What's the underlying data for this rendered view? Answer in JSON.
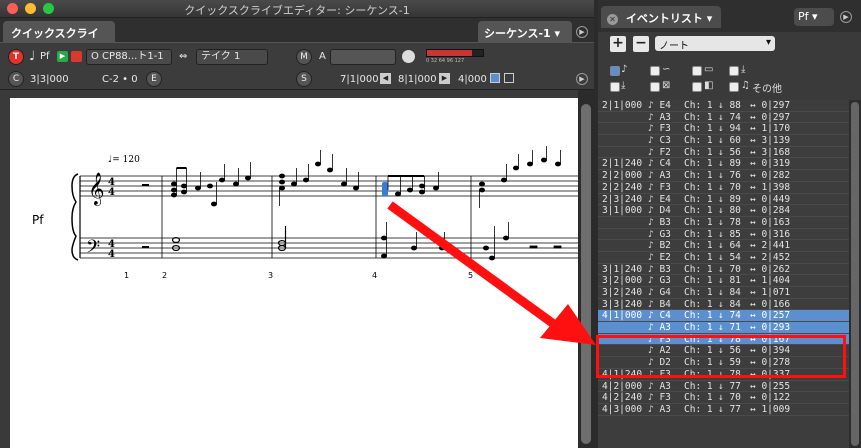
{
  "left_window": {
    "title": "クイックスクライブエディター: シーケンス-1",
    "tab_label": "クイックスクライブ",
    "sequence_selector": "シーケンス-1",
    "toolbar": {
      "t_button": "T",
      "pf_label": "Pf",
      "instrument": "O CP88...ト1-1",
      "take": "テイク 1",
      "m_button": "M",
      "a_button": "A",
      "meter_scale": "0  32  64  96 127",
      "c_label": "C",
      "position": "3|3|000",
      "key": "C-2 • 0",
      "e_button": "E",
      "s_button": "S",
      "locator_left": "7|1|000",
      "locator_right": "8|1|000",
      "end": "4|000"
    },
    "score": {
      "track_label": "Pf",
      "tempo_mark": "♩= 120",
      "measure_numbers": [
        "1",
        "2",
        "3",
        "4",
        "5"
      ]
    }
  },
  "right_window": {
    "tab_label": "イベントリスト",
    "part_selector": "Pf",
    "add_button": "+",
    "remove_button": "−",
    "event_type": "ノート",
    "filter_other": "その他",
    "events": [
      {
        "pos": "2|1|000",
        "note": "E4",
        "ch": "Ch: 1",
        "vel": "88",
        "len": "0|297"
      },
      {
        "pos": "",
        "note": "A3",
        "ch": "Ch: 1",
        "vel": "74",
        "len": "0|297"
      },
      {
        "pos": "",
        "note": "F3",
        "ch": "Ch: 1",
        "vel": "94",
        "len": "1|170"
      },
      {
        "pos": "",
        "note": "C3",
        "ch": "Ch: 1",
        "vel": "60",
        "len": "3|139"
      },
      {
        "pos": "",
        "note": "F2",
        "ch": "Ch: 1",
        "vel": "56",
        "len": "3|168"
      },
      {
        "pos": "2|1|240",
        "note": "C4",
        "ch": "Ch: 1",
        "vel": "89",
        "len": "0|319"
      },
      {
        "pos": "2|2|000",
        "note": "A3",
        "ch": "Ch: 1",
        "vel": "76",
        "len": "0|282"
      },
      {
        "pos": "2|2|240",
        "note": "F3",
        "ch": "Ch: 1",
        "vel": "70",
        "len": "1|398"
      },
      {
        "pos": "2|3|240",
        "note": "E4",
        "ch": "Ch: 1",
        "vel": "89",
        "len": "0|449"
      },
      {
        "pos": "3|1|000",
        "note": "D4",
        "ch": "Ch: 1",
        "vel": "80",
        "len": "0|284"
      },
      {
        "pos": "",
        "note": "B3",
        "ch": "Ch: 1",
        "vel": "78",
        "len": "0|163"
      },
      {
        "pos": "",
        "note": "G3",
        "ch": "Ch: 1",
        "vel": "85",
        "len": "0|316"
      },
      {
        "pos": "",
        "note": "B2",
        "ch": "Ch: 1",
        "vel": "64",
        "len": "2|441"
      },
      {
        "pos": "",
        "note": "E2",
        "ch": "Ch: 1",
        "vel": "54",
        "len": "2|452"
      },
      {
        "pos": "3|1|240",
        "note": "B3",
        "ch": "Ch: 1",
        "vel": "70",
        "len": "0|262"
      },
      {
        "pos": "3|2|000",
        "note": "G3",
        "ch": "Ch: 1",
        "vel": "81",
        "len": "1|404"
      },
      {
        "pos": "3|2|240",
        "note": "G4",
        "ch": "Ch: 1",
        "vel": "84",
        "len": "1|071"
      },
      {
        "pos": "3|3|240",
        "note": "B4",
        "ch": "Ch: 1",
        "vel": "84",
        "len": "0|166"
      },
      {
        "pos": "4|1|000",
        "note": "C4",
        "ch": "Ch: 1",
        "vel": "74",
        "len": "0|257",
        "highlight": true
      },
      {
        "pos": "",
        "note": "A3",
        "ch": "Ch: 1",
        "vel": "71",
        "len": "0|293",
        "highlight": true
      },
      {
        "pos": "",
        "note": "F3",
        "ch": "Ch: 1",
        "vel": "78",
        "len": "0|167",
        "highlight": true
      },
      {
        "pos": "",
        "note": "A2",
        "ch": "Ch: 1",
        "vel": "56",
        "len": "0|394"
      },
      {
        "pos": "",
        "note": "D2",
        "ch": "Ch: 1",
        "vel": "59",
        "len": "0|278"
      },
      {
        "pos": "4|1|240",
        "note": "F3",
        "ch": "Ch: 1",
        "vel": "78",
        "len": "0|337"
      },
      {
        "pos": "4|2|000",
        "note": "A3",
        "ch": "Ch: 1",
        "vel": "77",
        "len": "0|255"
      },
      {
        "pos": "4|2|240",
        "note": "F3",
        "ch": "Ch: 1",
        "vel": "70",
        "len": "0|122"
      },
      {
        "pos": "4|3|000",
        "note": "A3",
        "ch": "Ch: 1",
        "vel": "77",
        "len": "1|009"
      }
    ]
  },
  "colors": {
    "highlight": "#5b8fd0",
    "annotation_red": "#ff1010"
  }
}
